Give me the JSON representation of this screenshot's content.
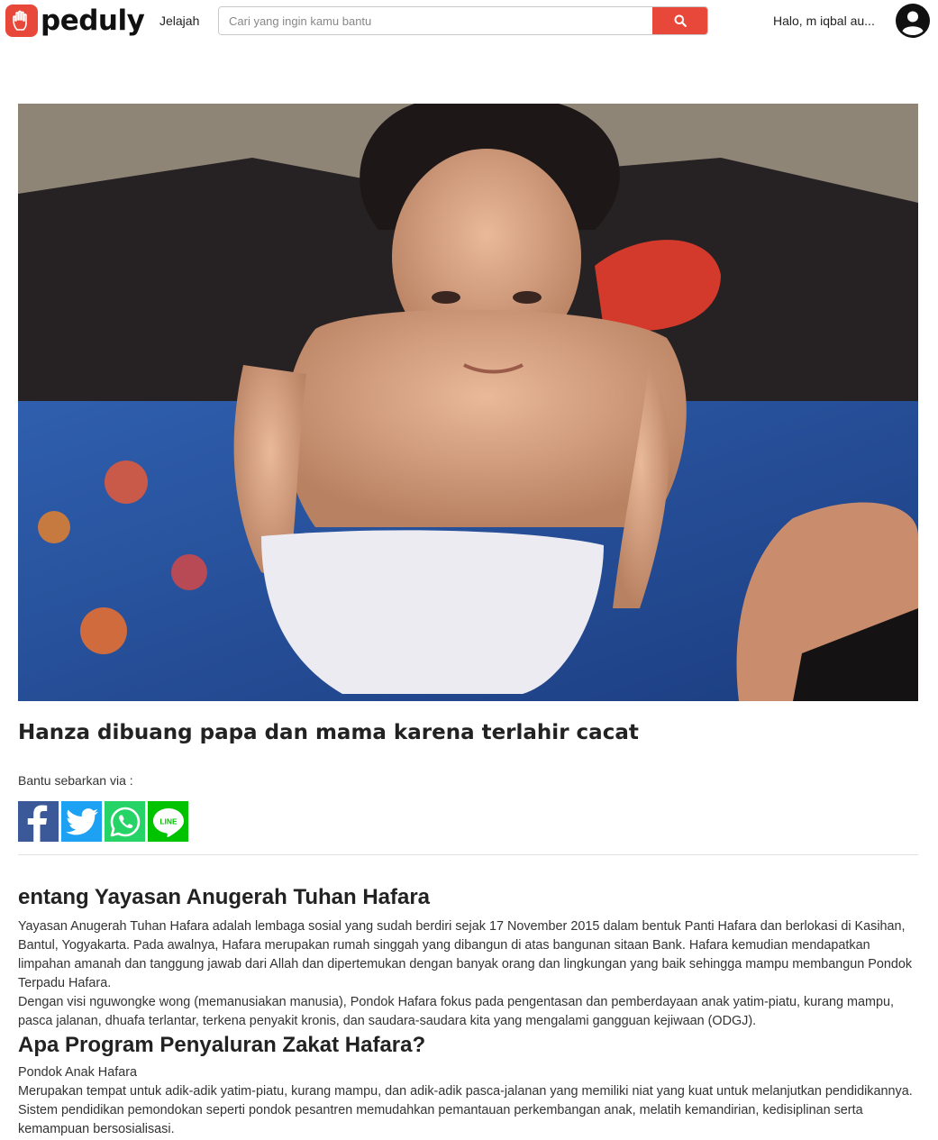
{
  "nav": {
    "brand": "peduly",
    "explore_label": "Jelajah",
    "search_placeholder": "Cari yang ingin kamu bantu",
    "greeting": "Halo, m iqbal au..."
  },
  "campaign": {
    "title": "Hanza dibuang papa dan mama karena terlahir cacat",
    "share_label": "Bantu sebarkan via :"
  },
  "share_buttons": [
    "facebook-icon",
    "twitter-icon",
    "whatsapp-icon",
    "line-icon"
  ],
  "colors": {
    "accent": "#e8483a",
    "facebook": "#3b5998",
    "twitter": "#1da1f2",
    "whatsapp": "#25d366",
    "line": "#00c300"
  },
  "story": {
    "section1_title": "entang Yayasan Anugerah Tuhan Hafara",
    "section1_p1": "Yayasan Anugerah Tuhan Hafara adalah lembaga sosial yang sudah berdiri sejak 17 November 2015 dalam bentuk Panti Hafara dan berlokasi di Kasihan, Bantul, Yogyakarta. Pada awalnya, Hafara merupakan rumah singgah yang dibangun di atas bangunan sitaan Bank. Hafara kemudian mendapatkan limpahan amanah dan tanggung jawab dari Allah dan dipertemukan dengan banyak orang dan lingkungan yang baik sehingga mampu membangun Pondok Terpadu Hafara.",
    "section1_p2": "Dengan visi nguwongke wong (memanusiakan manusia), Pondok Hafara fokus pada pengentasan dan pemberdayaan anak yatim-piatu, kurang mampu, pasca jalanan, dhuafa terlantar, terkena penyakit kronis, dan saudara-saudara kita yang mengalami gangguan kejiwaan (ODGJ).",
    "section2_title": "Apa Program Penyaluran Zakat Hafara?",
    "program_name": "Pondok Anak Hafara",
    "program_desc": "Merupakan tempat untuk adik-adik yatim-piatu, kurang mampu, dan adik-adik pasca-jalanan yang memiliki niat yang kuat untuk melanjutkan pendidikannya. Sistem pendidikan pemondokan seperti pondok pesantren memudahkan pemantauan perkembangan anak, melatih kemandirian, kedisiplinan serta kemampuan bersosialisasi."
  }
}
